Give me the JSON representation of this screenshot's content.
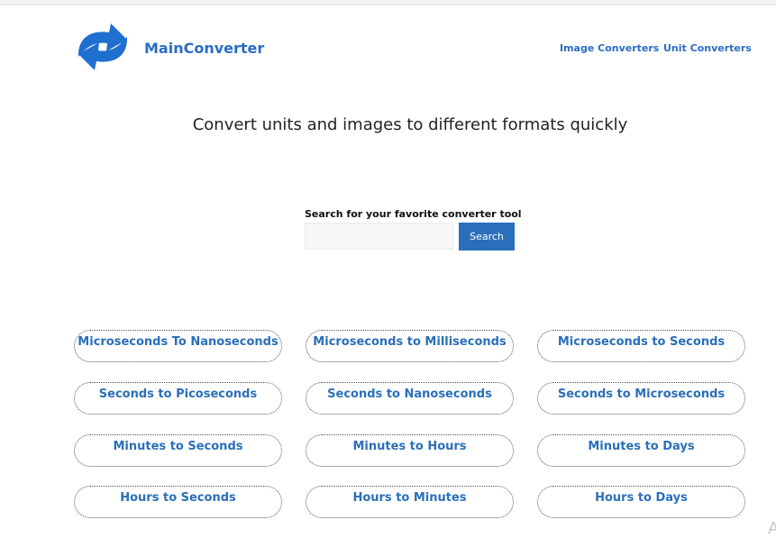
{
  "header": {
    "brand": "MainConverter",
    "logo_icon": "sync-arrows-icon",
    "nav": [
      {
        "label": "Image Converters"
      },
      {
        "label": "Unit Converters"
      }
    ]
  },
  "hero": {
    "tagline": "Convert units and images to different formats quickly"
  },
  "search": {
    "label": "Search for your favorite converter tool",
    "value": "",
    "button": "Search"
  },
  "tools": [
    {
      "label": "Microseconds To Nanoseconds"
    },
    {
      "label": "Microseconds to Milliseconds"
    },
    {
      "label": "Microseconds to Seconds"
    },
    {
      "label": "Seconds to Picoseconds"
    },
    {
      "label": "Seconds to Nanoseconds"
    },
    {
      "label": "Seconds to Microseconds"
    },
    {
      "label": "Minutes to Seconds"
    },
    {
      "label": "Minutes to Hours"
    },
    {
      "label": "Minutes to Days"
    },
    {
      "label": "Hours to Seconds"
    },
    {
      "label": "Hours to Minutes"
    },
    {
      "label": "Hours to Days"
    }
  ],
  "colors": {
    "accent": "#2a6fb9",
    "brand": "#2a6dc4",
    "logo": "#1f6fd1"
  }
}
